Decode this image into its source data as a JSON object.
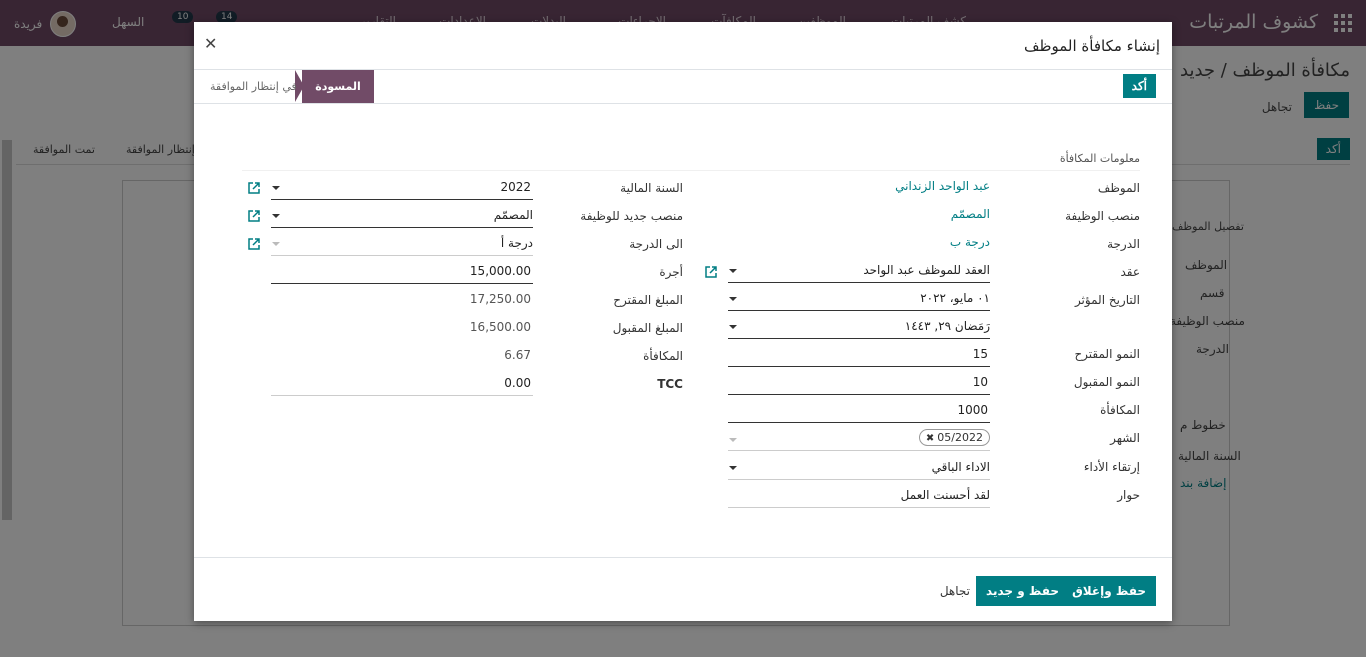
{
  "app": {
    "title": "كشوف المرتبات",
    "menu": [
      "التقارير",
      "الإعدادات",
      "البدلات",
      "الإجراءات",
      "المكافآت",
      "الموظفين",
      "كشف المرتبات"
    ],
    "user": "فريدة",
    "company": "السهل",
    "badge_messages": "14",
    "badge_activities": "10",
    "breadcrumb": "مكافأة الموظف / جديد",
    "save_label": "حفظ",
    "discard_label": "تجاهل",
    "confirm_label": "أكد",
    "stages": [
      "تمت الموافقة",
      "إنتظار الموافقة"
    ],
    "sheet_labels": [
      "تفصيل الموظف",
      "الموظف",
      "قسم",
      "منصب الوظيفة",
      "الدرجة",
      "خطوط م",
      "السنة المالية",
      "إضافة بند"
    ]
  },
  "modal": {
    "title": "إنشاء مكافأة الموظف",
    "confirm_label": "أكد",
    "stage_active": "المسودة",
    "stage_next": "في إنتظار الموافقة",
    "group_title": "معلومات المكافأة",
    "right": {
      "employee_label": "الموظف",
      "employee_value": "عبد الواحد الزنداني",
      "job_label": "منصب الوظيفة",
      "job_value": "المصمّم",
      "grade_label": "الدرجة",
      "grade_value": "درجة ب",
      "contract_label": "عقد",
      "contract_value": "العقد للموظف عبد الواحد",
      "effective_label": "التاريخ المؤثر",
      "effective_value": "٠١ مايو، ٢٠٢٢",
      "hijri_value": "رَمَضان ٢٩, ١٤٤٣",
      "proposed_growth_label": "النمو المقترح",
      "proposed_growth_value": "15",
      "accepted_growth_label": "النمو المقبول",
      "accepted_growth_value": "10",
      "reward_label": "المكافأة",
      "reward_value": "1000",
      "month_label": "الشهر",
      "month_value": "05/2022",
      "performance_label": "إرتقاء الأداء",
      "performance_value": "الاداء الباقي",
      "dialog_label": "حوار",
      "dialog_value": "لقد أحسنت العمل"
    },
    "left": {
      "fiscal_year_label": "السنة المالية",
      "fiscal_year_value": "2022",
      "new_job_label": "منصب جديد للوظيفة",
      "new_job_value": "المصمّم",
      "to_grade_label": "الى الدرجة",
      "to_grade_value": "درجة أ",
      "wage_label": "أجرة",
      "wage_value": "15,000.00",
      "proposed_amount_label": "المبلغ المقترح",
      "proposed_amount_value": "17,250.00",
      "accepted_amount_label": "المبلغ المقبول",
      "accepted_amount_value": "16,500.00",
      "reward_label": "المكافأة",
      "reward_value": "6.67",
      "tcc_label": "TCC",
      "tcc_value": "0.00"
    },
    "footer": {
      "save_close": "حفظ وإغلاق",
      "save_new": "حفظ و جديد",
      "discard": "تجاهل"
    }
  },
  "colors": {
    "brand": "#714b67",
    "accent": "#017e84"
  }
}
